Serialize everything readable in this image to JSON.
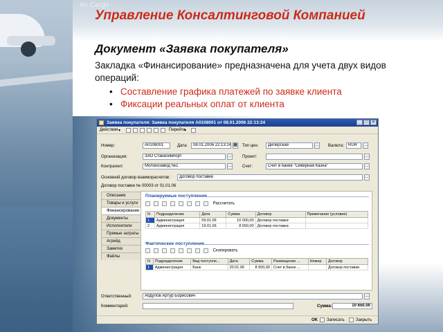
{
  "slide": {
    "title": "Управление Консалтинговой Компанией",
    "doc_title": "Документ «Заявка покупателя»",
    "description": "Закладка «Финансирование» предназначена для учета  двух видов операций:",
    "bullets": [
      "Составление графика платежей по заявке клиента",
      "Фиксации реальных оплат от клиента"
    ],
    "background_sign": "Air Cargo"
  },
  "window": {
    "title": "Заявка покупателя: Заявка покупателя А0108001 от 08.01.2006 22:13:24",
    "toolbar": {
      "actions": "Действия",
      "goto": "Перейти"
    },
    "header": {
      "number_label": "Номер:",
      "number": "А0108001",
      "date_label": "Дата:",
      "date": "08.01.2006 22:13:24",
      "price_type_label": "Тип цен:",
      "price_type": "Дилерская",
      "currency_label": "Валюта:",
      "currency": "RUR",
      "org_label": "Организация:",
      "org": "ЗАО Станкоимпорт",
      "project_label": "Проект:",
      "project": "",
      "contractor_label": "Контрагент:",
      "contractor": "Молокозавод №1",
      "account_label": "Счет:",
      "account": "Счет в банке \"Северная Казна\"",
      "main_contract_label": "Основной договор взаиморасчетов:",
      "main_contract": "Договор поставки",
      "supply_contract": "Договор поставки № 00003 от 01.01.06"
    },
    "tabs": [
      "Описание",
      "Товары и услуги",
      "Финансирование",
      "Документы",
      "Исполнители",
      "Прямые затраты",
      "Агрейд",
      "Заметки",
      "Файлы"
    ],
    "active_tab": 2,
    "planned": {
      "title": "Планируемые поступления",
      "calc_button": "Рассчитать",
      "columns": [
        "N",
        "Подразделение",
        "Дата",
        "Сумма",
        "Договор",
        "Примечание (условие)"
      ],
      "rows": [
        [
          "1",
          "Администрация",
          "09.01.06",
          "10 000,00",
          "Договор поставки",
          ""
        ],
        [
          "2",
          "Администрация",
          "19.01.06",
          "8 650,00",
          "Договор поставки",
          ""
        ]
      ]
    },
    "actual": {
      "title": "Фактические поступления",
      "copy_button": "Скопировать",
      "columns": [
        "N",
        "Подразделение",
        "Вид поступле...",
        "Дата",
        "Сумма",
        "Размещение ...",
        "Номер",
        "Договор"
      ],
      "rows": [
        [
          "1",
          "Администрация",
          "Банк",
          "20.01.06",
          "8 650,00",
          "Счет в банке ...",
          "",
          "Договор поставки"
        ]
      ]
    },
    "footer": {
      "responsible_label": "Ответственный:",
      "responsible": "Абдулов Артур Борисович",
      "comment_label": "Комментарий:",
      "comment": "",
      "sum_label": "Сумма:",
      "sum": "10 650.00",
      "ok": "OK",
      "save": "Записать",
      "close": "Закрыть"
    }
  }
}
